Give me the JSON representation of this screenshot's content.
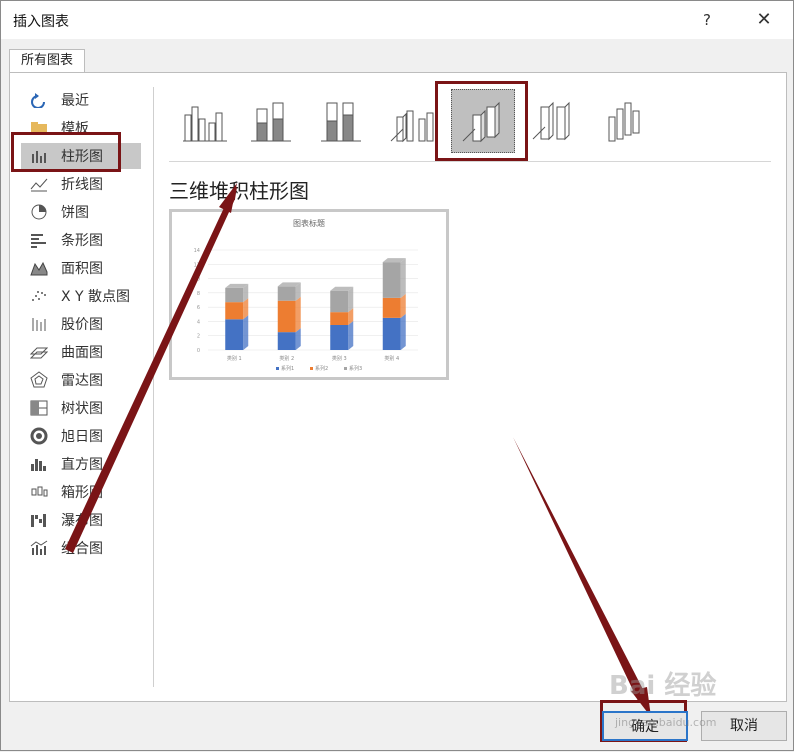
{
  "window": {
    "title": "插入图表",
    "help": "?",
    "close": "✕"
  },
  "tab": {
    "label": "所有图表"
  },
  "sidebar": {
    "items": [
      {
        "label": "最近",
        "icon": "recent-icon"
      },
      {
        "label": "模板",
        "icon": "template-folder-icon"
      },
      {
        "label": "柱形图",
        "icon": "column-chart-icon",
        "selected": true
      },
      {
        "label": "折线图",
        "icon": "line-chart-icon"
      },
      {
        "label": "饼图",
        "icon": "pie-chart-icon"
      },
      {
        "label": "条形图",
        "icon": "bar-chart-icon"
      },
      {
        "label": "面积图",
        "icon": "area-chart-icon"
      },
      {
        "label": "X Y 散点图",
        "icon": "scatter-chart-icon"
      },
      {
        "label": "股价图",
        "icon": "stock-chart-icon"
      },
      {
        "label": "曲面图",
        "icon": "surface-chart-icon"
      },
      {
        "label": "雷达图",
        "icon": "radar-chart-icon"
      },
      {
        "label": "树状图",
        "icon": "treemap-chart-icon"
      },
      {
        "label": "旭日图",
        "icon": "sunburst-chart-icon"
      },
      {
        "label": "直方图",
        "icon": "histogram-chart-icon"
      },
      {
        "label": "箱形图",
        "icon": "box-whisker-chart-icon"
      },
      {
        "label": "瀑布图",
        "icon": "waterfall-chart-icon"
      },
      {
        "label": "组合图",
        "icon": "combo-chart-icon"
      }
    ]
  },
  "subtypes": {
    "selected_index": 4,
    "selected_title": "三维堆积柱形图"
  },
  "preview": {
    "chart_data": {
      "type": "bar",
      "title": "图表标题",
      "categories": [
        "类别 1",
        "类别 2",
        "类别 3",
        "类别 4"
      ],
      "series": [
        {
          "name": "系列1",
          "values": [
            4.3,
            2.5,
            3.5,
            4.5
          ],
          "color": "#4472c4"
        },
        {
          "name": "系列2",
          "values": [
            2.4,
            4.4,
            1.8,
            2.8
          ],
          "color": "#ed7d31"
        },
        {
          "name": "系列3",
          "values": [
            2.0,
            2.0,
            3.0,
            5.0
          ],
          "color": "#a5a5a5"
        }
      ],
      "ylim": [
        0,
        14
      ],
      "yticks": [
        "0",
        "2",
        "4",
        "6",
        "8",
        "10",
        "12",
        "14"
      ],
      "stacked": true,
      "legend": "bottom"
    }
  },
  "buttons": {
    "ok": "确定",
    "cancel": "取消"
  },
  "watermark": {
    "main": "Bai 经验",
    "sub": "jingyan.baidu.com"
  },
  "colors": {
    "highlight": "#7a1416",
    "selected_bg": "#c8c8c8"
  }
}
